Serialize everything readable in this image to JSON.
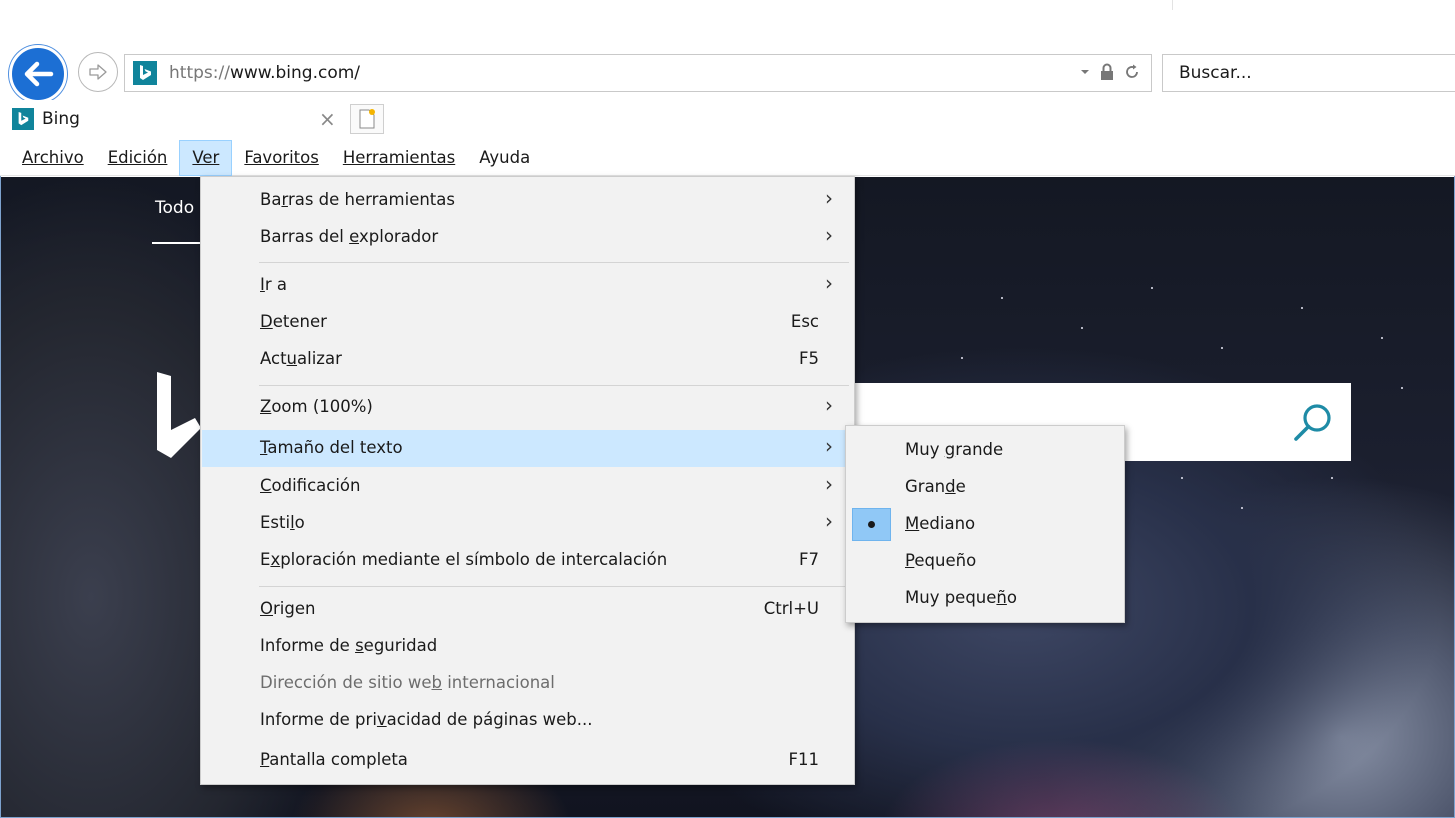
{
  "browser": {
    "url_host_prefix": "https://",
    "url_rest": "www.bing.com/",
    "search_placeholder": "Buscar...",
    "tab_title": "Bing",
    "tab_close": "×"
  },
  "menu_bar": {
    "items": [
      {
        "label": "Archivo"
      },
      {
        "label": "Edición"
      },
      {
        "label": "Ver"
      },
      {
        "label": "Favoritos"
      },
      {
        "label": "Herramientas"
      },
      {
        "label": "Ayuda"
      }
    ]
  },
  "page": {
    "tab_text": "Todo"
  },
  "view_menu": {
    "items": [
      {
        "pre": "Ba",
        "u": "r",
        "post": "ras de herramientas",
        "shortcut": "",
        "submenu": true
      },
      {
        "pre": "Barras del ",
        "u": "e",
        "post": "xplorador",
        "shortcut": "",
        "submenu": true
      },
      {
        "pre": "",
        "u": "I",
        "post": "r a",
        "shortcut": "",
        "submenu": true
      },
      {
        "pre": "",
        "u": "D",
        "post": "etener",
        "shortcut": "Esc",
        "submenu": false
      },
      {
        "pre": "Act",
        "u": "u",
        "post": "alizar",
        "shortcut": "F5",
        "submenu": false
      },
      {
        "pre": "",
        "u": "Z",
        "post": "oom (100%)",
        "shortcut": "",
        "submenu": true
      },
      {
        "pre": "",
        "u": "T",
        "post": "amaño del texto",
        "shortcut": "",
        "submenu": true
      },
      {
        "pre": "",
        "u": "C",
        "post": "odificación",
        "shortcut": "",
        "submenu": true
      },
      {
        "pre": "Esti",
        "u": "l",
        "post": "o",
        "shortcut": "",
        "submenu": true
      },
      {
        "pre": "E",
        "u": "x",
        "post": "ploración mediante el símbolo de intercalación",
        "shortcut": "F7",
        "submenu": false
      },
      {
        "pre": "",
        "u": "O",
        "post": "rigen",
        "shortcut": "Ctrl+U",
        "submenu": false
      },
      {
        "pre": "Informe de ",
        "u": "s",
        "post": "eguridad",
        "shortcut": "",
        "submenu": false
      },
      {
        "pre": "Dirección de sitio we",
        "u": "b",
        "post": " internacional",
        "shortcut": "",
        "submenu": false,
        "disabled": true
      },
      {
        "pre": "Informe de pri",
        "u": "v",
        "post": "acidad de páginas web...",
        "shortcut": "",
        "submenu": false
      },
      {
        "pre": "",
        "u": "P",
        "post": "antalla completa",
        "shortcut": "F11",
        "submenu": false
      }
    ]
  },
  "text_size_menu": {
    "items": [
      {
        "pre": "Muy ",
        "u": "g",
        "post": "rande",
        "selected": false
      },
      {
        "pre": "Gran",
        "u": "d",
        "post": "e",
        "selected": false
      },
      {
        "pre": "",
        "u": "M",
        "post": "ediano",
        "selected": true
      },
      {
        "pre": "",
        "u": "P",
        "post": "equeño",
        "selected": false
      },
      {
        "pre": "Muy peque",
        "u": "ñ",
        "post": "o",
        "selected": false
      }
    ]
  },
  "colors": {
    "back_button": "#1c6fd4",
    "bing_logo": "#10849b",
    "menu_highlight": "#cce8ff"
  }
}
